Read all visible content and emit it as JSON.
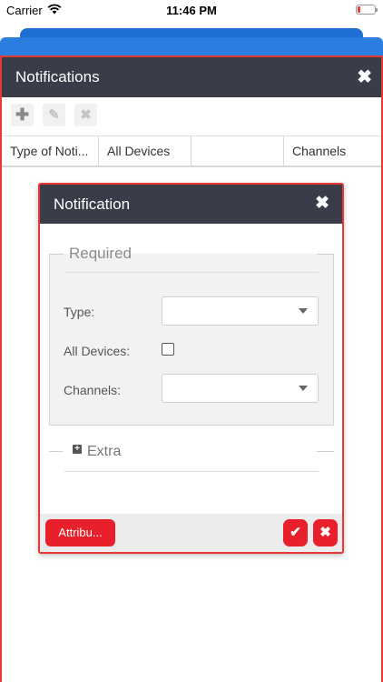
{
  "status_bar": {
    "carrier": "Carrier",
    "time": "11:46 PM",
    "battery_level": 0.15,
    "battery_color": "#e8413a"
  },
  "outer_dialog": {
    "title": "Notifications",
    "close_icon": "close-icon",
    "toolbar": {
      "add_icon": "plus-icon",
      "edit_icon": "pencil-icon",
      "delete_icon": "close-icon"
    },
    "columns": [
      "Type of Noti...",
      "All Devices",
      "",
      "Channels"
    ]
  },
  "inner_dialog": {
    "title": "Notification",
    "close_icon": "close-icon",
    "required_section": {
      "legend": "Required",
      "type_label": "Type:",
      "type_value": "",
      "all_devices_label": "All Devices:",
      "all_devices_checked": false,
      "channels_label": "Channels:",
      "channels_value": ""
    },
    "extra_section": {
      "label": "Extra",
      "expand_icon": "plus-square-icon"
    },
    "footer": {
      "attributes_label": "Attribu...",
      "confirm_icon": "check-icon",
      "cancel_icon": "close-icon"
    }
  },
  "colors": {
    "header_bg": "#3a3c4a",
    "accent_red": "#e8202c",
    "border_red": "#e53935",
    "blue": "#1f6fd2"
  }
}
